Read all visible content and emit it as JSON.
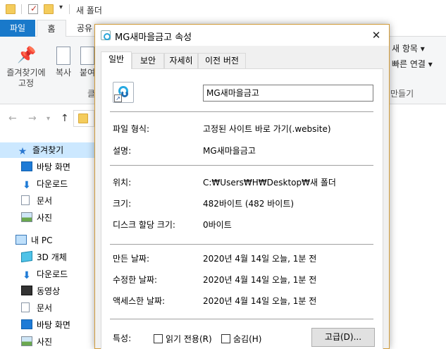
{
  "explorer": {
    "window_title": "새 폴더",
    "tabs": {
      "file": "파일",
      "home": "홈",
      "share": "공유"
    },
    "ribbon": {
      "pin_label_line1": "즐겨찾기에",
      "pin_label_line2": "고정",
      "copy_label": "복사",
      "paste_label": "붙여",
      "group_label_clipboard": "클",
      "new_item": "새 항목 ▾",
      "easy_access": "빠른 연결 ▾",
      "group_label_new": "만들기"
    },
    "nav": {
      "quick_access": "즐겨찾기",
      "desktop": "바탕 화면",
      "downloads": "다운로드",
      "documents": "문서",
      "pictures": "사진",
      "this_pc": "내 PC",
      "objects3d": "3D 개체",
      "downloads2": "다운로드",
      "videos": "동영상",
      "documents2": "문서",
      "desktop2": "바탕 화면",
      "pictures2": "사진"
    }
  },
  "dialog": {
    "title": "MG새마을금고 속성",
    "tabs": [
      "일반",
      "보안",
      "자세히",
      "이전 버전"
    ],
    "file_name": "MG새마을금고",
    "rows": {
      "file_type_label": "파일 형식:",
      "file_type_value": "고정된 사이트 바로 가기(.website)",
      "description_label": "설명:",
      "description_value": "MG새마을금고",
      "location_label": "위치:",
      "location_value": "C:₩Users₩H₩Desktop₩새 폴더",
      "size_label": "크기:",
      "size_value": "482바이트 (482 바이트)",
      "size_on_disk_label": "디스크 할당 크기:",
      "size_on_disk_value": "0바이트",
      "created_label": "만든 날짜:",
      "created_value": "2020년 4월 14일 오늘, 1분 전",
      "modified_label": "수정한 날짜:",
      "modified_value": "2020년 4월 14일 오늘, 1분 전",
      "accessed_label": "액세스한 날짜:",
      "accessed_value": "2020년 4월 14일 오늘, 1분 전",
      "attributes_label": "특성:",
      "readonly_label": "읽기 전용(R)",
      "hidden_label": "숨김(H)",
      "advanced_button": "고급(D)..."
    }
  }
}
